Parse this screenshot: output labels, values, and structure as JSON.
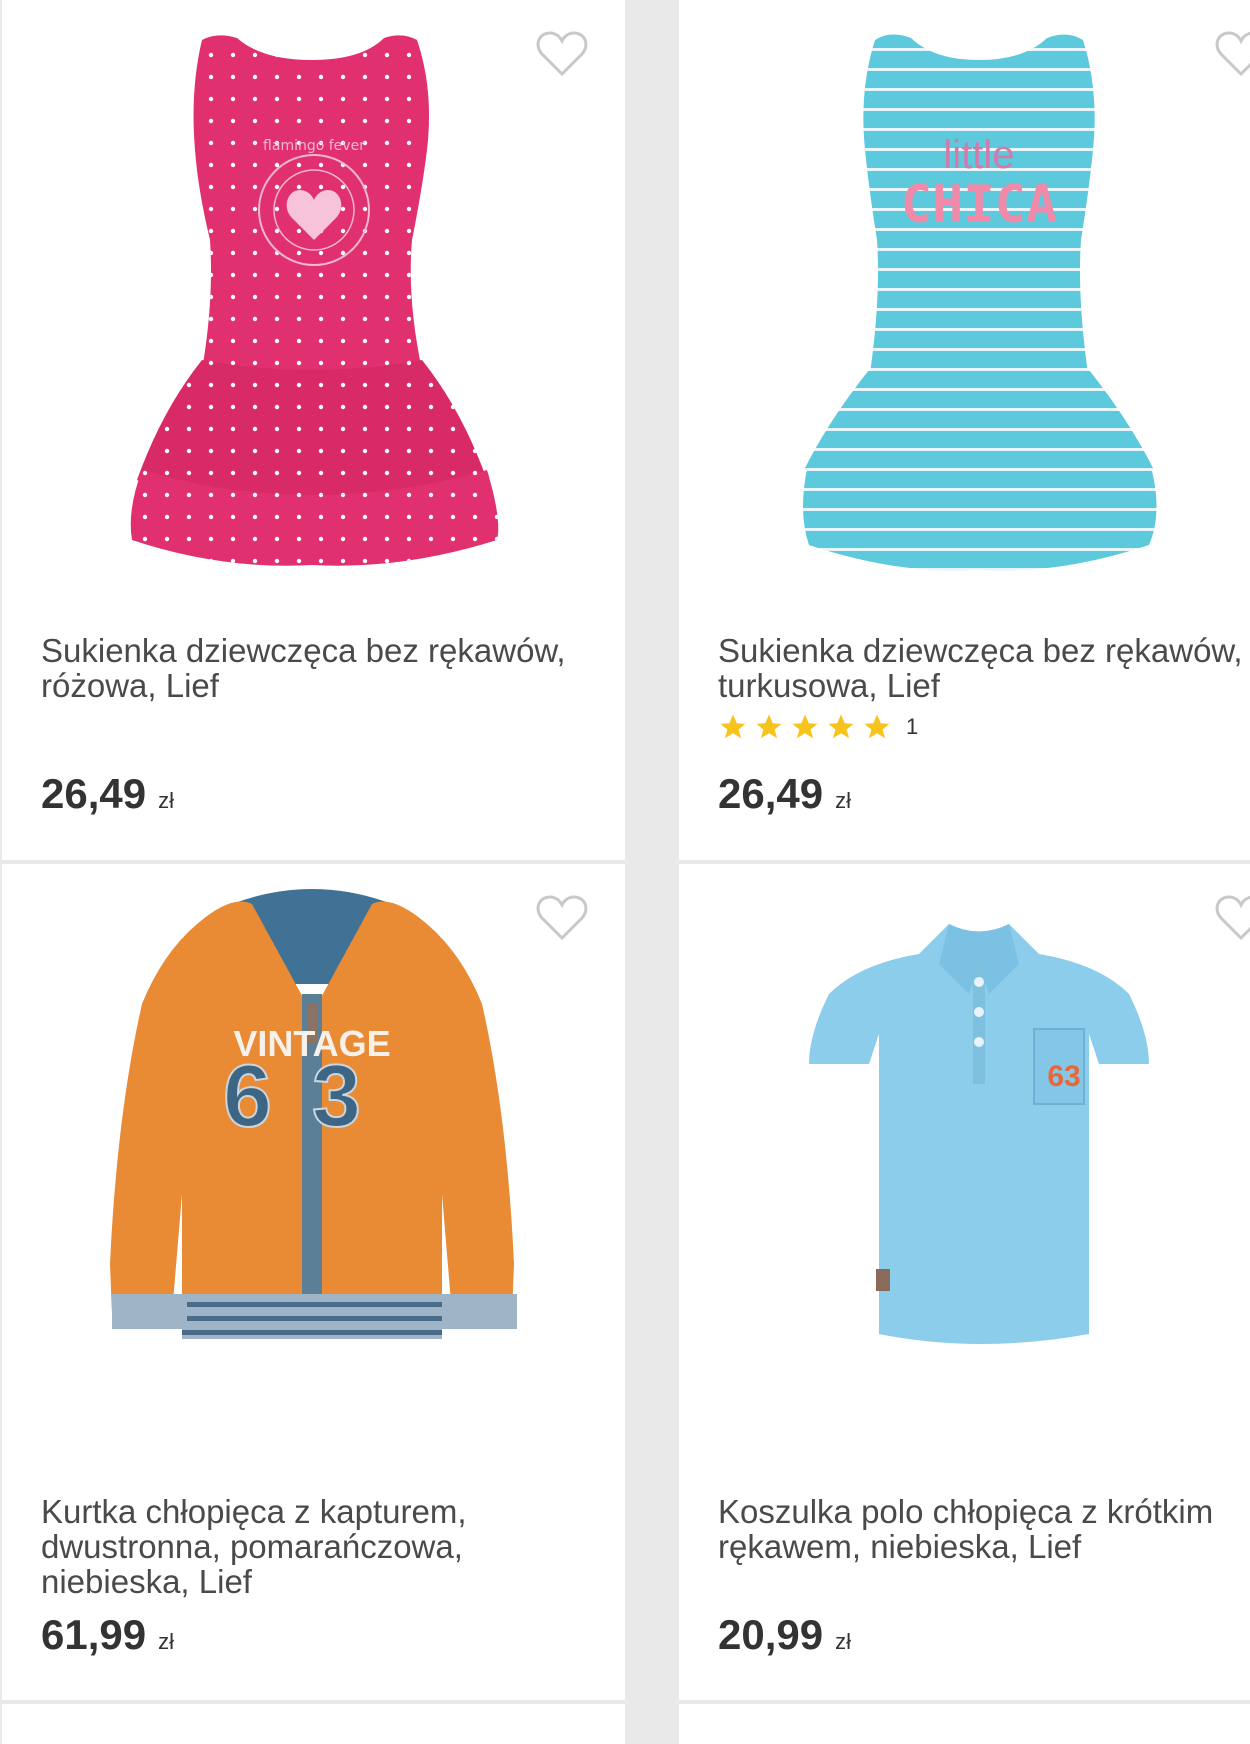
{
  "products": [
    {
      "title": "Sukienka dziewczęca bez rękawów, różowa, Lief",
      "title_lines": [
        "Sukienka dziewczęca bez rękawów,",
        "różowa, Lief"
      ],
      "price": "26,49",
      "currency": "zł",
      "image_icon": "pink-dress-image",
      "print_text": "flamingo fever"
    },
    {
      "title": "Sukienka dziewczęca bez rękawów, turkusowa, Lief",
      "title_lines": [
        "Sukienka dziewczęca bez rękawów,",
        "turkusowa, Lief"
      ],
      "price": "26,49",
      "currency": "zł",
      "rating_stars": 5,
      "rating_count": "1",
      "image_icon": "turquoise-dress-image",
      "print_text_1": "little",
      "print_text_2": "CHICA"
    },
    {
      "title": "Kurtka chłopięca z kapturem, dwustronna, pomarańczowa, niebieska, Lief",
      "title_lines": [
        "Kurtka chłopięca z kapturem,",
        "dwustronna, pomarańczowa,",
        "niebieska, Lief"
      ],
      "price": "61,99",
      "currency": "zł",
      "image_icon": "orange-hoodie-image",
      "print_text_1": "VINTAGE",
      "print_text_2": "63"
    },
    {
      "title": "Koszulka polo chłopięca z krótkim rękawem, niebieska, Lief",
      "title_lines": [
        "Koszulka polo chłopięca z krótkim",
        "rękawem, niebieska, Lief"
      ],
      "price": "20,99",
      "currency": "zł",
      "image_icon": "blue-polo-image",
      "print_text": "63"
    }
  ],
  "colors": {
    "background": "#e9e9e9",
    "card": "#ffffff",
    "title": "#4a4a4a",
    "price": "#333333",
    "star": "#f7c31d",
    "heart_outline": "#c8c8c8"
  }
}
